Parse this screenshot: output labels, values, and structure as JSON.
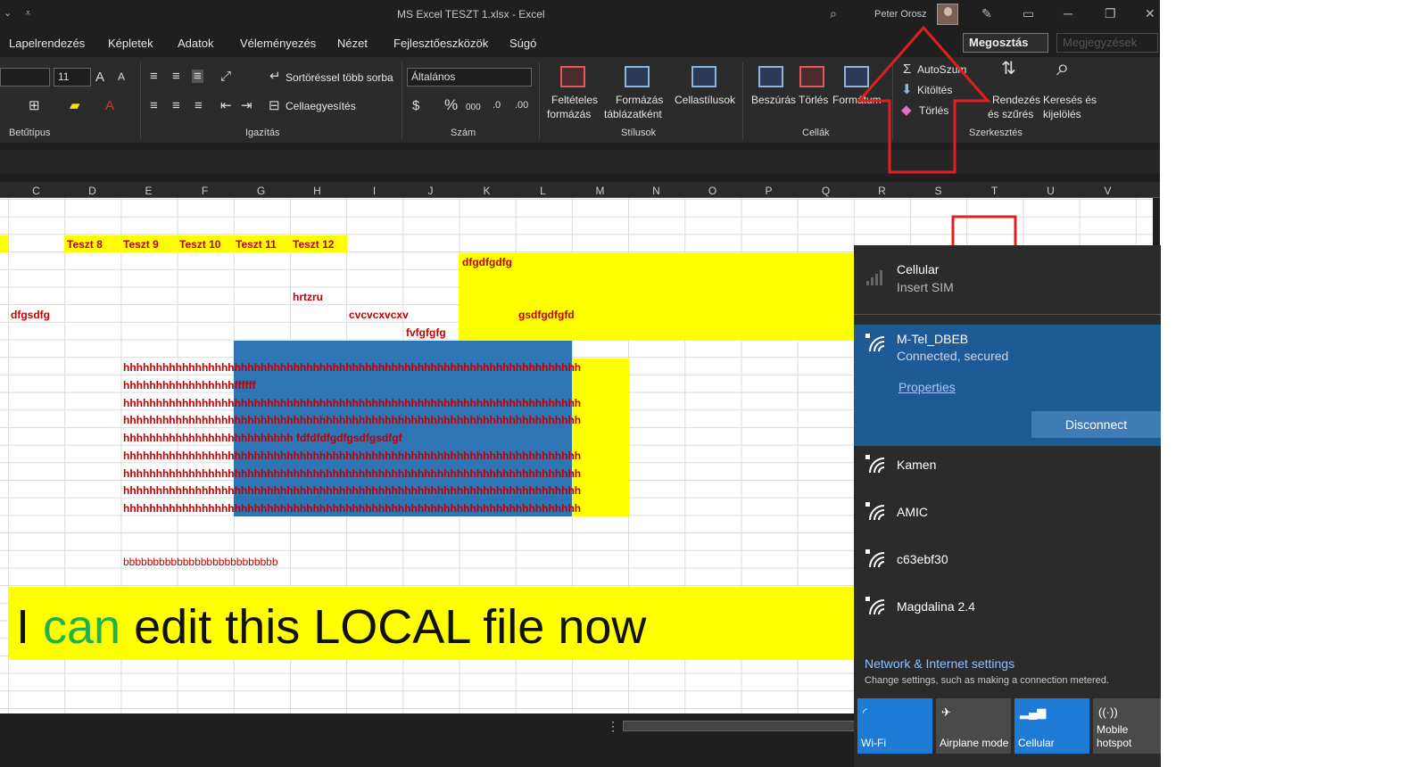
{
  "title": {
    "document": "MS Excel TESZT 1.xlsx  -  Excel",
    "user": "Peter Orosz"
  },
  "menu": {
    "items": [
      "Lapelrendezés",
      "Képletek",
      "Adatok",
      "Véleményezés",
      "Nézet",
      "Fejlesztőeszközök",
      "Súgó"
    ],
    "share": "Megosztás",
    "comments": "Megjegyzések"
  },
  "ribbon": {
    "font_size": "11",
    "wrap_text": "Sortöréssel több sorba",
    "merge": "Cellaegyesítés",
    "number_format": "Általános",
    "cond_format": "Feltételes",
    "cond_format2": "formázás",
    "format_table": "Formázás",
    "format_table2": "táblázatként",
    "cell_styles": "Cellastílusok",
    "insert": "Beszúrás",
    "delete": "Törlés",
    "format": "Formátum",
    "autosum": "AutoSzum",
    "fill": "Kitöltés",
    "clear": "Törlés",
    "sort": "Rendezés",
    "sort2": "és szűrés",
    "find": "Keresés és",
    "find2": "kijelölés",
    "groups": {
      "font": "Betűtípus",
      "align": "Igazítás",
      "number": "Szám",
      "styles": "Stílusok",
      "cells": "Cellák",
      "editing": "Szerkesztés"
    }
  },
  "columns": [
    "C",
    "D",
    "E",
    "F",
    "G",
    "H",
    "I",
    "J",
    "K",
    "L",
    "M",
    "N",
    "O",
    "P",
    "Q",
    "R",
    "S",
    "T",
    "U",
    "V"
  ],
  "cells": {
    "teszt8": "Teszt 8",
    "teszt9": "Teszt 9",
    "teszt10": "Teszt 10",
    "teszt11": "Teszt 11",
    "teszt12": "Teszt 12",
    "dfgdfgdfg": "dfgdfgdfg",
    "hrtzru": "hrtzru",
    "dfgsdfg": "dfgsdfg",
    "cvcvcxvcxv": "cvcvcxvcxv",
    "gsdfgdfgfd": "gsdfgdfgfd",
    "fvfgfgfg": "fvfgfgfg",
    "hrows": [
      "hhhhhhhhhhhhhhhhhhhhhhhhhhhhhhhhhhhhhhhhhhhhhhhhhhhhhhhhhhhhhhhhhhhhhhhhhhhh",
      "hhhhhhhhhhhhhhhhhffffff",
      "hhhhhhhhhhhhhhhhhhhhhhhhhhhhhhhhhhhhhhhhhhhhhhhhhhhhhhhhhhhhhhhhhhhhhhhhhhhh",
      "hhhhhhhhhhhhhhhhhhhhhhhhhhhhhhhhhhhhhhhhhhhhhhhhhhhhhhhhhhhhhhhhhhhhhhhhhhhh",
      "hhhhhhhhhhhhhhhhhhhhhhhhhh fdfdfdfgdfgsdfgsdfgf",
      "hhhhhhhhhhhhhhhhhhhhhhhhhhhhhhhhhhhhhhhhhhhhhhhhhhhhhhhhhhhhhhhhhhhhhhhhhhhh",
      "hhhhhhhhhhhhhhhhhhhhhhhhhhhhhhhhhhhhhhhhhhhhhhhhhhhhhhhhhhhhhhhhhhhhhhhhhhhh",
      "hhhhhhhhhhhhhhhhhhhhhhhhhhhhhhhhhhhhhhhhhhhhhhhhhhhhhhhhhhhhhhhhhhhhhhhhhhhh",
      "hhhhhhhhhhhhhhhhhhhhhhhhhhhhhhhhhhhhhhhhhhhhhhhhhhhhhhhhhhhhhhhhhhhhhhhhhhhh"
    ],
    "bbb": "bbbbbbbbbbbbbbbbbbbbbbbbbb",
    "big1": "I ",
    "big2": "can",
    "big3": " edit  this LOCAL file now"
  },
  "network": {
    "cellular": {
      "name": "Cellular",
      "status": "Insert SIM"
    },
    "connected": {
      "name": "M-Tel_DBEB",
      "status": "Connected, secured",
      "properties": "Properties",
      "disconnect": "Disconnect"
    },
    "others": [
      "Kamen",
      "AMIC",
      "c63ebf30",
      "Magdalina 2.4"
    ],
    "settings": "Network & Internet settings",
    "settings_sub": "Change settings, such as making a connection metered.",
    "tiles": [
      "Wi-Fi",
      "Airplane mode",
      "Cellular",
      "Mobile hotspot"
    ]
  },
  "colors": {
    "yellow": "#ffff00",
    "blue": "#2e75b6",
    "red_text": "#c00000",
    "green_text": "#22b14c",
    "accent": "#1e5a96"
  }
}
